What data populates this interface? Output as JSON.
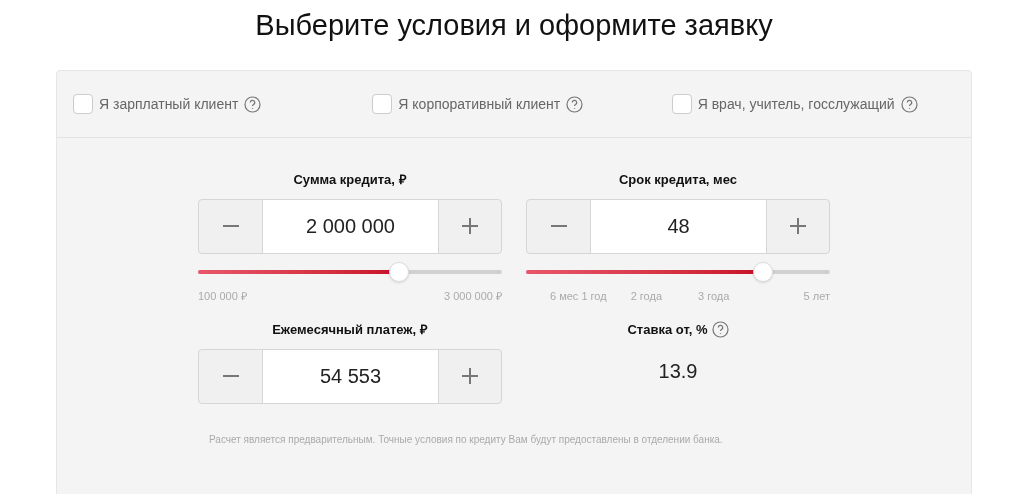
{
  "title": "Выберите условия и оформите заявку",
  "options": [
    {
      "label": "Я зарплатный клиент",
      "checked": false
    },
    {
      "label": "Я корпоративный клиент",
      "checked": false
    },
    {
      "label": "Я врач, учитель, госслужащий",
      "checked": false
    }
  ],
  "loan_amount": {
    "label": "Сумма кредита, ₽",
    "value": "2 000 000",
    "level": 0.66,
    "ticks": [
      "100 000 ₽",
      "3 000 000 ₽"
    ]
  },
  "loan_term": {
    "label": "Срок кредита, мес",
    "value": "48",
    "level": 0.78,
    "ticks": [
      "6 мес 1 год",
      "2 года",
      "3 года",
      "5 лет"
    ]
  },
  "monthly_payment": {
    "label": "Ежемесячный платеж, ₽",
    "value": "54 553"
  },
  "rate": {
    "label": "Ставка от, %",
    "value": "13.9"
  },
  "disclaimer": "Расчет является предварительным. Точные условия по кредиту Вам будут предоставлены в отделении банка."
}
